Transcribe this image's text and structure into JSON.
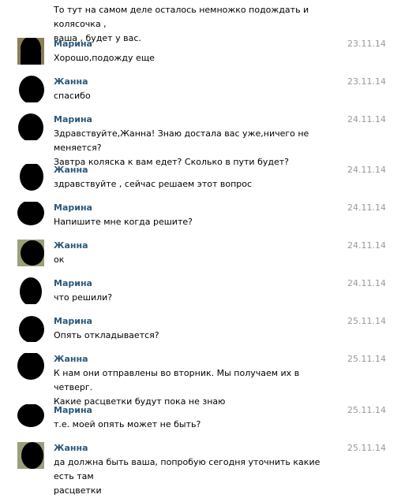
{
  "chat": {
    "top_text": "То тут на самом деле осталось немножко подождать и колясочка ,\nваша , будет у вас.",
    "messages": [
      {
        "author": "Марина",
        "date": "23.11.14",
        "text": "Хорошо,подожду еще"
      },
      {
        "author": "Жанна",
        "date": "23.11.14",
        "text": "спасибо"
      },
      {
        "author": "Марина",
        "date": "24.11.14",
        "text": "Здравствуйте,Жанна! Знаю достала вас уже,ничего не меняется?\nЗавтра коляска к вам едет? Сколько в пути будет?"
      },
      {
        "author": "Жанна",
        "date": "24.11.14",
        "text": "здравствуйте , сейчас решаем этот вопрос"
      },
      {
        "author": "Марина",
        "date": "24.11.14",
        "text": "Напишите мне когда решите?"
      },
      {
        "author": "Жанна",
        "date": "24.11.14",
        "text": "ок"
      },
      {
        "author": "Марина",
        "date": "24.11.14",
        "text": "что решили?"
      },
      {
        "author": "Марина",
        "date": "25.11.14",
        "text": "Опять откладывается?"
      },
      {
        "author": "Жанна",
        "date": "25.11.14",
        "text": "К нам они отправлены во вторник. Мы получаем их в четверг.\nКакие расцветки будут пока не знаю"
      },
      {
        "author": "Марина",
        "date": "25.11.14",
        "text": "т.е. моей опять может не быть?"
      },
      {
        "author": "Жанна",
        "date": "25.11.14",
        "text": "да должна быть ваша, попробую сегодня уточнить какие есть там\nрасцветки"
      }
    ]
  }
}
